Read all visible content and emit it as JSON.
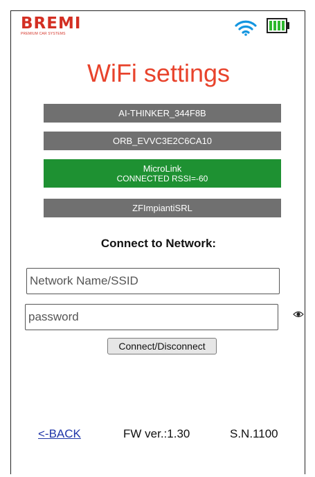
{
  "header": {
    "logo_main": "BREMI",
    "logo_sub": "PREMIUM CAR SYSTEMS",
    "wifi_icon": "wifi-icon",
    "battery_icon": "battery-full-icon"
  },
  "page": {
    "title": "WiFi settings"
  },
  "networks": [
    {
      "ssid": "AI-THINKER_344F8B",
      "status": ""
    },
    {
      "ssid": "ORB_EVVC3E2C6CA10",
      "status": ""
    },
    {
      "ssid": "MicroLink",
      "status": "CONNECTED RSSI=-60"
    },
    {
      "ssid": "ZFImpiantiSRL",
      "status": ""
    }
  ],
  "connect": {
    "heading": "Connect to Network:",
    "ssid_placeholder": "Network Name/SSID",
    "password_placeholder": "password",
    "button_label": "Connect/Disconnect",
    "show_password_icon": "eye-icon"
  },
  "footer": {
    "back_label": "<-BACK",
    "fw_version": "FW ver.:1.30",
    "serial": "S.N.1100"
  },
  "colors": {
    "brand_red": "#d32f23",
    "title_red": "#e8432c",
    "network_gray": "#707070",
    "connected_green": "#1e9132",
    "wifi_blue": "#1596e0",
    "battery_green": "#2eb82e",
    "link_blue": "#1f35a8"
  }
}
